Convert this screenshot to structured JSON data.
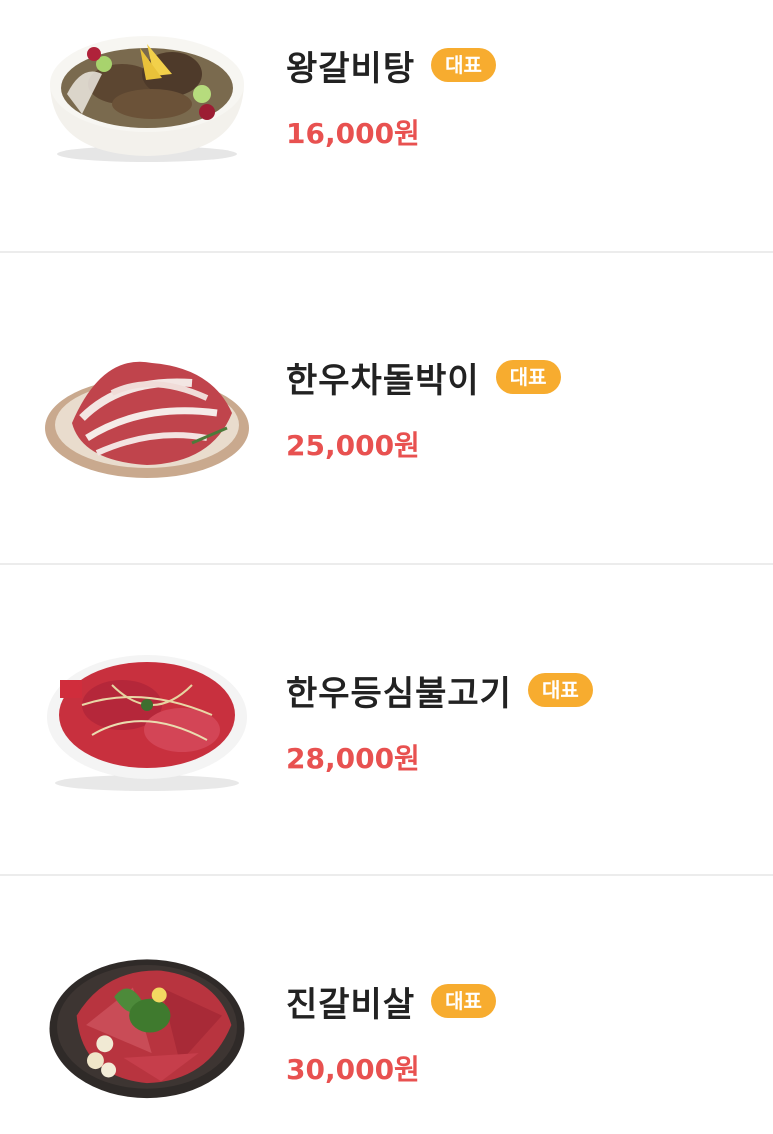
{
  "menu": {
    "items": [
      {
        "name": "왕갈비탕",
        "badge": "대표",
        "price": "16,000원",
        "image": "galbitang-soup-bowl"
      },
      {
        "name": "한우차돌박이",
        "badge": "대표",
        "price": "25,000원",
        "image": "beef-brisket-plate"
      },
      {
        "name": "한우등심불고기",
        "badge": "대표",
        "price": "28,000원",
        "image": "sirloin-bulgogi-plate"
      },
      {
        "name": "진갈비살",
        "badge": "대표",
        "price": "30,000원",
        "image": "rib-meat-platter"
      }
    ]
  },
  "colors": {
    "badge": "#f7ac2f",
    "price": "#e85150",
    "name": "#222222",
    "divider": "#ececec"
  }
}
